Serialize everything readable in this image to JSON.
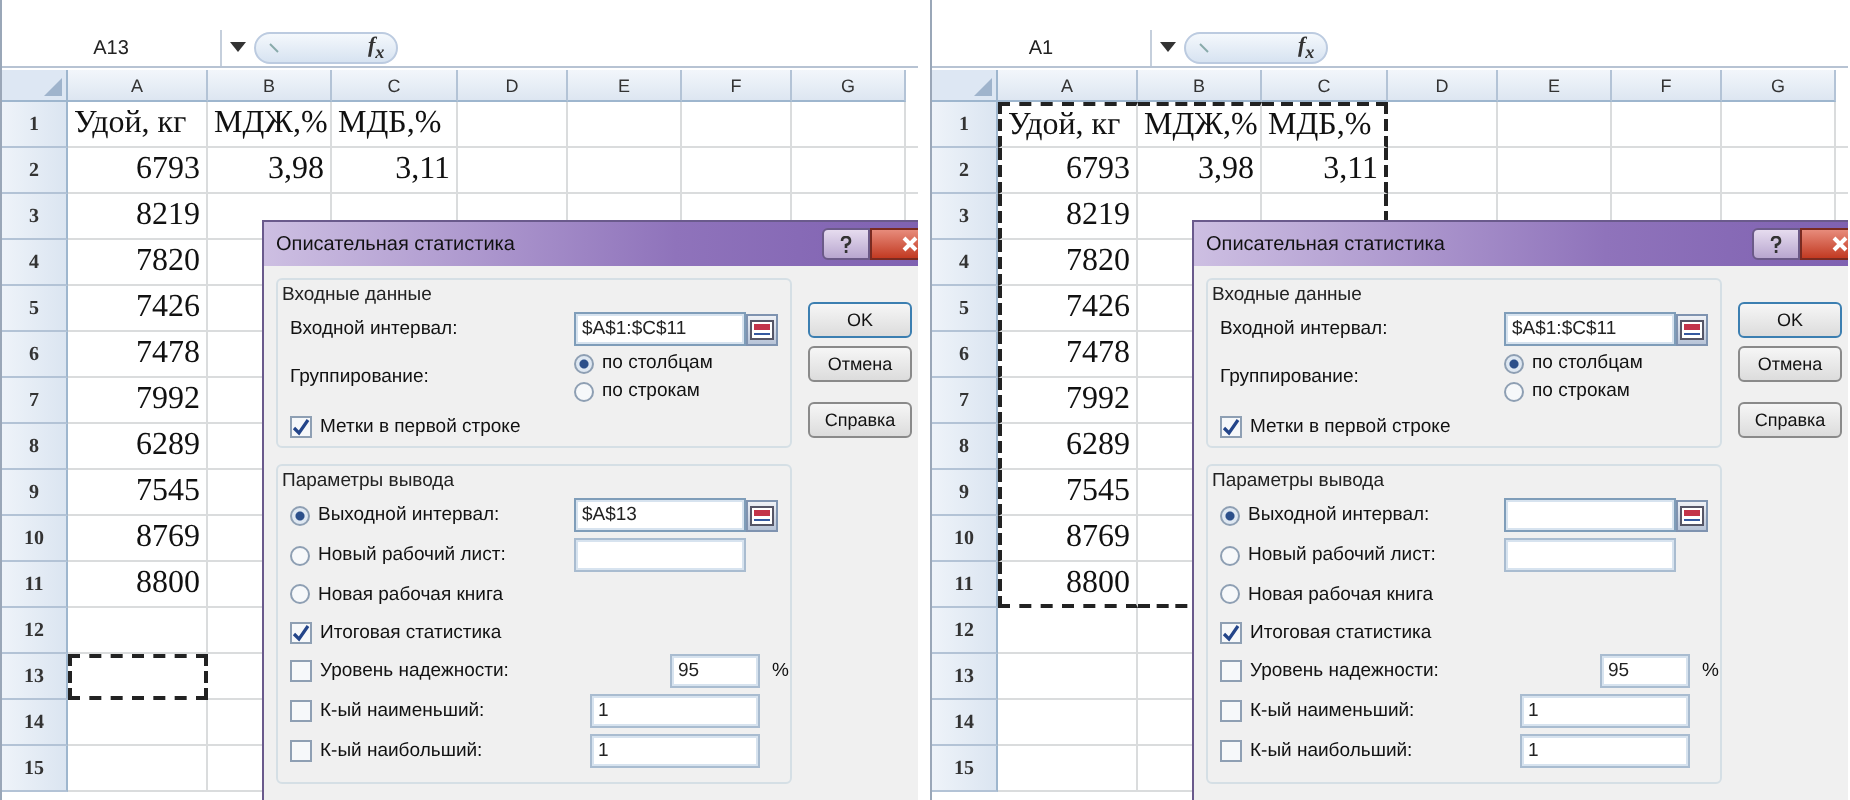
{
  "panels": [
    {
      "name_box": "A13",
      "function_button": "f$_{x}$",
      "columns": [
        "A",
        "B",
        "C",
        "D",
        "E",
        "F",
        "G"
      ],
      "rows": [
        {
          "number": "1",
          "cells": [
            {
              "text": "Удой, кг",
              "kind": "text"
            },
            {
              "text": "МДЖ,%",
              "kind": "text"
            },
            {
              "text": "МДБ,%",
              "kind": "text"
            }
          ]
        },
        {
          "number": "2",
          "cells": [
            {
              "text": "6793",
              "kind": "number"
            },
            {
              "text": "3,98",
              "kind": "number"
            },
            {
              "text": "3,11",
              "kind": "number"
            }
          ]
        },
        {
          "number": "3",
          "cells": [
            {
              "text": "8219",
              "kind": "number"
            }
          ]
        },
        {
          "number": "4",
          "cells": [
            {
              "text": "7820",
              "kind": "number"
            }
          ]
        },
        {
          "number": "5",
          "cells": [
            {
              "text": "7426",
              "kind": "number"
            }
          ]
        },
        {
          "number": "6",
          "cells": [
            {
              "text": "7478",
              "kind": "number"
            }
          ]
        },
        {
          "number": "7",
          "cells": [
            {
              "text": "7992",
              "kind": "number"
            }
          ]
        },
        {
          "number": "8",
          "cells": [
            {
              "text": "6289",
              "kind": "number"
            }
          ]
        },
        {
          "number": "9",
          "cells": [
            {
              "text": "7545",
              "kind": "number"
            }
          ]
        },
        {
          "number": "10",
          "cells": [
            {
              "text": "8769",
              "kind": "number"
            }
          ]
        },
        {
          "number": "11",
          "cells": [
            {
              "text": "8800",
              "kind": "number"
            }
          ]
        },
        {
          "number": "12",
          "cells": []
        },
        {
          "number": "13",
          "cells": [
            {
              "kind": "empty",
              "marquee_top": true,
              "marquee_right": true,
              "marquee_bottom": true,
              "marquee_left": true
            }
          ]
        },
        {
          "number": "14",
          "cells": []
        },
        {
          "number": "15",
          "cells": []
        }
      ],
      "dialog": {
        "title": "Описательная статистика",
        "input_group": {
          "legend": "Входные данные",
          "range_label": "Входной интервал:",
          "range_value": "$A$1:$C$11",
          "grouping_label": "Группирование:",
          "grouping_options": [
            {
              "label": "по столбцам",
              "selected": true
            },
            {
              "label": "по строкам",
              "selected": false
            }
          ],
          "labels_checkbox": {
            "label": "Метки в первой строке",
            "checked": true
          }
        },
        "output_group": {
          "legend": "Параметры вывода",
          "options": [
            {
              "label": "Выходной интервал:",
              "selected": true,
              "kind": "field",
              "value": "$A$13"
            },
            {
              "label": "Новый рабочий лист:",
              "selected": false,
              "kind": "field"
            },
            {
              "label": "Новая рабочая книга",
              "selected": false,
              "kind": "plain"
            }
          ],
          "checks": [
            {
              "label": "Итоговая статистика",
              "checked": true,
              "kind": "plain"
            },
            {
              "label": "Уровень надежности:",
              "checked": false,
              "kind": "field",
              "value": "95",
              "unit": "%"
            },
            {
              "label": "К-ый наименьший:",
              "checked": false,
              "kind": "field",
              "value": "1"
            },
            {
              "label": "К-ый наибольший:",
              "checked": false,
              "kind": "field",
              "value": "1"
            }
          ]
        },
        "buttons": [
          "OK",
          "Отмена",
          "Справка"
        ]
      }
    },
    {
      "name_box": "A1",
      "function_button": "f$_{x}$",
      "columns": [
        "A",
        "B",
        "C",
        "D",
        "E",
        "F",
        "G"
      ],
      "rows": [
        {
          "number": "1",
          "cells": [
            {
              "text": "Удой, кг",
              "kind": "text",
              "marquee_top": true,
              "marquee_left": true
            },
            {
              "text": "МДЖ,%",
              "kind": "text",
              "marquee_top": true
            },
            {
              "text": "МДБ,%",
              "kind": "text",
              "marquee_top": true,
              "marquee_right": true
            }
          ]
        },
        {
          "number": "2",
          "cells": [
            {
              "text": "6793",
              "kind": "number",
              "marquee_left": true
            },
            {
              "text": "3,98",
              "kind": "number"
            },
            {
              "text": "3,11",
              "kind": "number",
              "marquee_right": true
            }
          ]
        },
        {
          "number": "3",
          "cells": [
            {
              "text": "8219",
              "kind": "number",
              "marquee_left": true
            },
            {
              "kind": "empty"
            },
            {
              "kind": "empty",
              "marquee_right": true
            }
          ]
        },
        {
          "number": "4",
          "cells": [
            {
              "text": "7820",
              "kind": "number",
              "marquee_left": true
            }
          ]
        },
        {
          "number": "5",
          "cells": [
            {
              "text": "7426",
              "kind": "number",
              "marquee_left": true
            }
          ]
        },
        {
          "number": "6",
          "cells": [
            {
              "text": "7478",
              "kind": "number",
              "marquee_left": true
            }
          ]
        },
        {
          "number": "7",
          "cells": [
            {
              "text": "7992",
              "kind": "number",
              "marquee_left": true
            }
          ]
        },
        {
          "number": "8",
          "cells": [
            {
              "text": "6289",
              "kind": "number",
              "marquee_left": true
            }
          ]
        },
        {
          "number": "9",
          "cells": [
            {
              "text": "7545",
              "kind": "number",
              "marquee_left": true
            }
          ]
        },
        {
          "number": "10",
          "cells": [
            {
              "text": "8769",
              "kind": "number",
              "marquee_left": true
            }
          ]
        },
        {
          "number": "11",
          "cells": [
            {
              "text": "8800",
              "kind": "number",
              "marquee_left": true,
              "marquee_bottom": true
            },
            {
              "kind": "empty",
              "marquee_bottom": true
            }
          ]
        },
        {
          "number": "12",
          "cells": []
        },
        {
          "number": "13",
          "cells": []
        },
        {
          "number": "14",
          "cells": []
        },
        {
          "number": "15",
          "cells": []
        }
      ],
      "dialog": {
        "title": "Описательная статистика",
        "input_group": {
          "legend": "Входные данные",
          "range_label": "Входной интервал:",
          "range_value": "$A$1:$C$11",
          "grouping_label": "Группирование:",
          "grouping_options": [
            {
              "label": "по столбцам",
              "selected": true
            },
            {
              "label": "по строкам",
              "selected": false
            }
          ],
          "labels_checkbox": {
            "label": "Метки в первой строке",
            "checked": true
          }
        },
        "output_group": {
          "legend": "Параметры вывода",
          "options": [
            {
              "label": "Выходной интервал:",
              "selected": true,
              "kind": "field"
            },
            {
              "label": "Новый рабочий лист:",
              "selected": false,
              "kind": "field"
            },
            {
              "label": "Новая рабочая книга",
              "selected": false,
              "kind": "plain"
            }
          ],
          "checks": [
            {
              "label": "Итоговая статистика",
              "checked": true,
              "kind": "plain"
            },
            {
              "label": "Уровень надежности:",
              "checked": false,
              "kind": "field",
              "value": "95",
              "unit": "%"
            },
            {
              "label": "К-ый наименьший:",
              "checked": false,
              "kind": "field",
              "value": "1"
            },
            {
              "label": "К-ый наибольший:",
              "checked": false,
              "kind": "field",
              "value": "1"
            }
          ]
        },
        "buttons": [
          "OK",
          "Отмена",
          "Справка"
        ]
      }
    }
  ]
}
